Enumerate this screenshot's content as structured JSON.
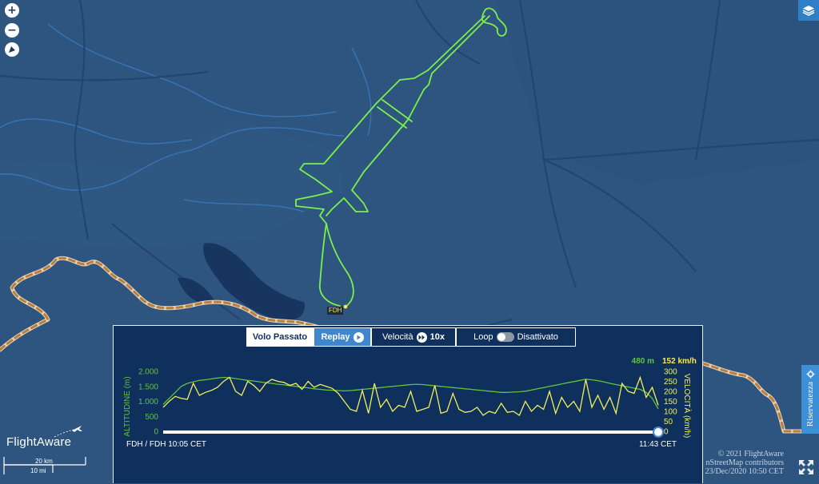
{
  "map": {
    "zoom_in_label": "+",
    "zoom_out_label": "−",
    "airport_label": "FDH",
    "colors": {
      "background": "#2d5580",
      "track": "#7cf04a",
      "border": "#e7b16a",
      "lake": "#17355e"
    }
  },
  "sidebar": {
    "privacy_label": "Riservatezza"
  },
  "branding": {
    "name": "FlightAware"
  },
  "scale": {
    "km_label": "20 km",
    "mi_label": "10 mi"
  },
  "attribution": {
    "line1": "© 2021 FlightAware",
    "line2": "nStreetMap contributors",
    "line3": "23/Dec/2020 10:50 CET"
  },
  "panel": {
    "tabs": {
      "past_flight": "Volo Passato",
      "replay": "Replay",
      "speed": "Velocità",
      "speed_value": "10x",
      "loop": "Loop",
      "loop_state": "Disattivato"
    },
    "chart_data": {
      "type": "line",
      "xlabel": "",
      "ylabel_left": "ALTITUDINE (m)",
      "ylabel_right": "VELOCITÀ (km/h)",
      "yticks_left": [
        "2.000",
        "1.500",
        "1.000",
        "500",
        "0"
      ],
      "yticks_right": [
        "300",
        "250",
        "200",
        "150",
        "100",
        "50",
        "0"
      ],
      "ylim_left": [
        0,
        2000
      ],
      "ylim_right": [
        0,
        300
      ],
      "current_altitude": "480 m",
      "current_speed": "152 km/h",
      "start_label": "FDH / FDH 10:05 CET",
      "end_label": "11:43 CET",
      "progress": 1.0,
      "series": [
        {
          "name": "altitude",
          "color": "#5ec53d",
          "values": [
            900,
            1100,
            1300,
            1500,
            1600,
            1650,
            1700,
            1720,
            1750,
            1780,
            1800,
            1790,
            1760,
            1730,
            1700,
            1680,
            1650,
            1620,
            1600,
            1570,
            1550,
            1520,
            1500,
            1470,
            1450,
            1420,
            1400,
            1380,
            1370,
            1360,
            1350,
            1360,
            1380,
            1400,
            1420,
            1440,
            1460,
            1480,
            1500,
            1520,
            1540,
            1560,
            1570,
            1560,
            1540,
            1520,
            1500,
            1480,
            1460,
            1440,
            1420,
            1400,
            1380,
            1360,
            1340,
            1320,
            1300,
            1300,
            1310,
            1320,
            1340,
            1380,
            1420,
            1460,
            1500,
            1540,
            1580,
            1620,
            1660,
            1700,
            1740,
            1720,
            1690,
            1650,
            1600,
            1560,
            1520,
            1480,
            1440,
            1400,
            1300,
            1100,
            750
          ]
        },
        {
          "name": "speed",
          "color": "#f1f05b",
          "values": [
            120,
            150,
            175,
            165,
            160,
            240,
            180,
            195,
            205,
            220,
            250,
            270,
            200,
            180,
            250,
            230,
            200,
            240,
            260,
            250,
            245,
            230,
            240,
            210,
            250,
            220,
            235,
            225,
            215,
            190,
            150,
            110,
            100,
            205,
            90,
            240,
            120,
            160,
            100,
            130,
            120,
            200,
            100,
            110,
            120,
            230,
            90,
            100,
            190,
            110,
            95,
            100,
            120,
            80,
            100,
            90,
            140,
            95,
            100,
            80,
            150,
            100,
            130,
            110,
            200,
            90,
            170,
            120,
            150,
            100,
            260,
            120,
            180,
            110,
            170,
            90,
            240,
            200,
            190,
            270,
            170,
            220,
            130
          ]
        }
      ]
    }
  }
}
